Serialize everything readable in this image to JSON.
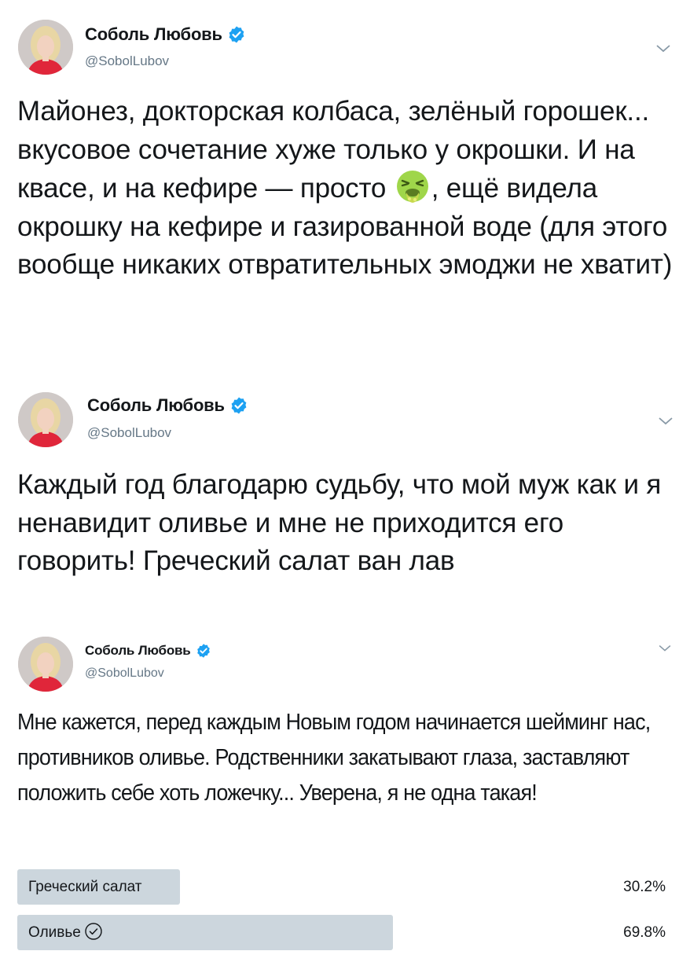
{
  "tweets": [
    {
      "author": {
        "name": "Соболь Любовь",
        "handle": "@SobolLubov"
      },
      "text_before_emoji": "Майонез, докторская колбаса, зелёный горошек... вкусовое сочетание хуже только у окрошки. И на квасе, и на кефире — просто ",
      "emoji": "face-vomiting-emoji",
      "text_after_emoji": ", ещё видела окрошку на кефире и газированной воде (для этого вообще никаких отвратительных эмоджи не хватит)"
    },
    {
      "author": {
        "name": "Соболь Любовь",
        "handle": "@SobolLubov"
      },
      "text": "Каждый год благодарю судьбу, что мой муж как и я ненавидит оливье и мне не приходится его говорить! Греческий салат ван лав"
    },
    {
      "author": {
        "name": "Соболь Любовь",
        "handle": "@SobolLubov"
      },
      "text": "Мне кажется, перед каждым Новым годом начинается шейминг нас, противников оливье. Родственники закатывают глаза, заставляют положить себе хоть ложечку... Уверена, я не одна такая!",
      "poll": [
        {
          "label": "Греческий салат",
          "percent_text": "30.2%",
          "percent": 30.2,
          "selected": false
        },
        {
          "label": "Оливье",
          "percent_text": "69.8%",
          "percent": 69.8,
          "selected": true
        }
      ]
    }
  ],
  "colors": {
    "verified": "#1da1f2",
    "handle": "#657786",
    "poll_bar": "#ccd6dd",
    "text": "#14171a"
  }
}
